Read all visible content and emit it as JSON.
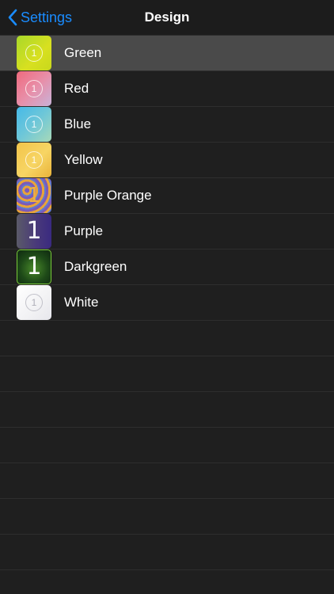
{
  "navbar": {
    "back_label": "Settings",
    "title": "Design"
  },
  "designs": [
    {
      "label": "Green",
      "badge": "1",
      "style": "ring",
      "selected": true
    },
    {
      "label": "Red",
      "badge": "1",
      "style": "ring",
      "selected": false
    },
    {
      "label": "Blue",
      "badge": "1",
      "style": "ring",
      "selected": false
    },
    {
      "label": "Yellow",
      "badge": "1",
      "style": "ring",
      "selected": false
    },
    {
      "label": "Purple Orange",
      "badge": "1",
      "style": "pattern",
      "selected": false
    },
    {
      "label": "Purple",
      "badge": "1",
      "style": "big",
      "selected": false
    },
    {
      "label": "Darkgreen",
      "badge": "1",
      "style": "big",
      "selected": false
    },
    {
      "label": "White",
      "badge": "1",
      "style": "ring",
      "selected": false
    }
  ],
  "colors": {
    "accent": "#1a8cff",
    "background": "#1f1f1f",
    "selected_row": "#4a4a4a",
    "separator": "#2e2e2e"
  }
}
